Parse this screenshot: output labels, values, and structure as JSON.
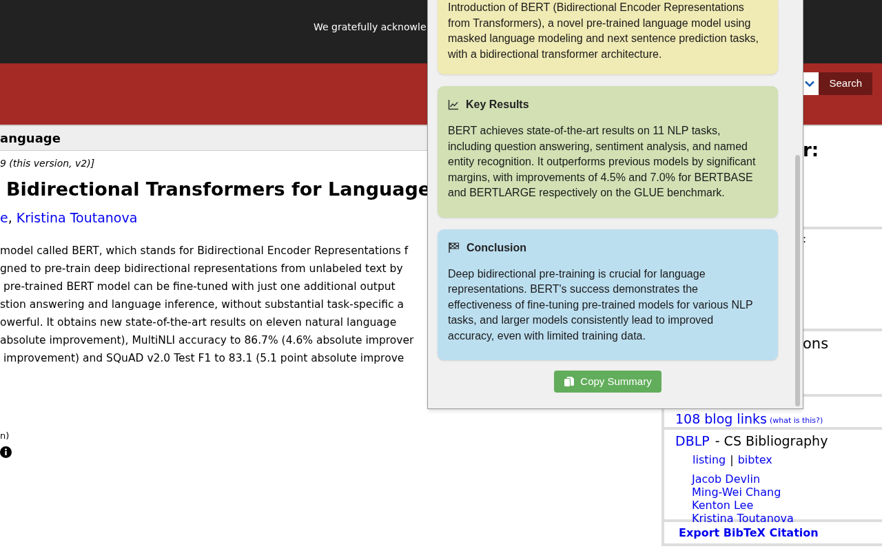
{
  "banner": {
    "text": "We gratefully acknowle"
  },
  "search": {
    "button": "Search"
  },
  "breadcrumb": "anguage",
  "paper": {
    "version": "9 (this version, v2)]",
    "title": "Bidirectional Transformers for Language",
    "authors": [
      "e",
      "Kristina Toutanova"
    ],
    "author_separator": ",",
    "abstract_lines": [
      {
        "text": "model called BERT, which stands for Bidirectional Encoder Representations f",
        "indent": false
      },
      {
        "text": "gned to pre-train deep bidirectional representations from unlabeled text by",
        "indent": false
      },
      {
        "text": "pre-trained BERT model can be fine-tuned with just one additional output",
        "indent": true
      },
      {
        "text": "stion answering and language inference, without substantial task-specific a",
        "indent": false
      },
      {
        "text": "owerful. It obtains new state-of-the-art results on eleven natural language",
        "indent": false
      },
      {
        "text": "absolute improvement), MultiNLI accuracy to 86.7% (4.6% absolute improver",
        "indent": false
      },
      {
        "text": "improvement) and SQuAD v2.0 Test F1 to 83.1 (5.1 point absolute improve",
        "indent": true
      }
    ],
    "comments_fragment": "n)"
  },
  "sidebar": {
    "fragments": [
      "r:",
      ":",
      "ons"
    ],
    "blog_links": {
      "label": "108 blog links",
      "help": "(what is this?)"
    },
    "dblp": {
      "title": "DBLP",
      "subtitle": "- CS Bibliography",
      "links": [
        "listing",
        "bibtex"
      ],
      "separator": "|",
      "authors": [
        "Jacob Devlin",
        "Ming-Wei Chang",
        "Kenton Lee",
        "Kristina Toutanova"
      ]
    },
    "export": "Export BibTeX Citation"
  },
  "summary_panel": {
    "cards": [
      {
        "kind": "intro",
        "color": "#f0eab4",
        "text": "Introduction of BERT (Bidirectional Encoder Representations from Transformers), a novel pre-trained language model using masked language modeling and next sentence prediction tasks, with a bidirectional transformer architecture."
      },
      {
        "kind": "results",
        "color": "#d2e0b4",
        "heading": "Key Results",
        "text": "BERT achieves state-of-the-art results on 11 NLP tasks, including question answering, sentiment analysis, and named entity recognition. It outperforms previous models by significant margins, with improvements of 4.5% and 7.0% for BERTBASE and BERTLARGE respectively on the GLUE benchmark."
      },
      {
        "kind": "conclusion",
        "color": "#bcdff0",
        "heading": "Conclusion",
        "text": "Deep bidirectional pre-training is crucial for language representations. BERT's success demonstrates the effectiveness of fine-tuning pre-trained models for various NLP tasks, and larger models consistently lead to improved accuracy, even with limited training data."
      }
    ],
    "copy_button": "Copy Summary"
  }
}
